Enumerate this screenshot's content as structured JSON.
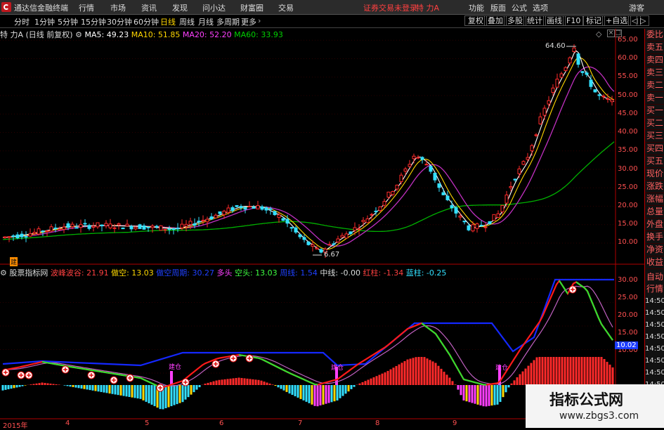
{
  "menubar": {
    "app_title": "通达信金融终端",
    "items": [
      "行情",
      "市场",
      "资讯",
      "发现",
      "问小达",
      "财富圈",
      "交易"
    ],
    "status": "证券交易未登录",
    "stock": "特 力A",
    "right_items": [
      "功能",
      "版面",
      "公式",
      "选项"
    ],
    "user": "游客"
  },
  "toolbar": {
    "periods": [
      "分时",
      "1分钟",
      "5分钟",
      "15分钟",
      "30分钟",
      "60分钟",
      "日线",
      "周线",
      "月线",
      "多周期",
      "更多"
    ],
    "selected": "日线",
    "right_buttons": [
      "复权",
      "叠加",
      "多股",
      "统计",
      "画线",
      "F10",
      "标记",
      "+自选",
      "◁",
      "▷"
    ]
  },
  "main_info": {
    "title": "特 力A (日线 前复权)",
    "ma5": "MA5: 49.23",
    "ma10": "MA10: 51.85",
    "ma20": "MA20: 52.20",
    "ma60": "MA60: 33.93"
  },
  "main_axis": [
    "65.00",
    "60.00",
    "55.00",
    "50.00",
    "45.00",
    "40.00",
    "35.00",
    "30.00",
    "25.00",
    "20.00",
    "15.00",
    "10.00"
  ],
  "high_label": "64.60",
  "low_label": "6.67",
  "sidebar_right": [
    "委比",
    "卖五",
    "卖四",
    "卖三",
    "卖二",
    "卖一",
    "买一",
    "买二",
    "买三",
    "买四",
    "买五",
    "现价",
    "涨跌",
    "涨幅",
    "总量",
    "外盘",
    "换手",
    "净资",
    "收益"
  ],
  "sidebar_right2": [
    "自动",
    "行情"
  ],
  "indicator_info": {
    "name": "股票指标网",
    "t1": "波峰波谷: 21.91",
    "t2": "做空: 13.03",
    "t3": "做空周期: 30.27",
    "t4": "多头",
    "t5": "空头: 13.03",
    "t6": "周线: 1.54",
    "t7": "中线: -0.00",
    "t8": "红柱: -1.34",
    "t9": "蓝柱: -0.25"
  },
  "ind_axis": [
    "30.00",
    "25.00",
    "20.00",
    "15.00",
    "10.00"
  ],
  "ind_current": "10.02",
  "time_ticks": [
    "14:50",
    "14:50",
    "14:50",
    "14:50",
    "14:50",
    "14:50",
    "14:50",
    "14:50"
  ],
  "x_ticks": [
    "2015年",
    "4",
    "5",
    "6",
    "7",
    "8",
    "9"
  ],
  "watermark": {
    "title": "指标公式网",
    "url": "www.zbgs3.com"
  },
  "markers": {
    "jian": "建",
    "jiancang": "建仓"
  },
  "colors": {
    "bg": "#000000",
    "up": "#ff2a2a",
    "down": "#33e0ff",
    "ma5": "#ffffff",
    "ma10": "#ffd700",
    "ma20": "#ff40ff",
    "ma60": "#00c000"
  }
}
